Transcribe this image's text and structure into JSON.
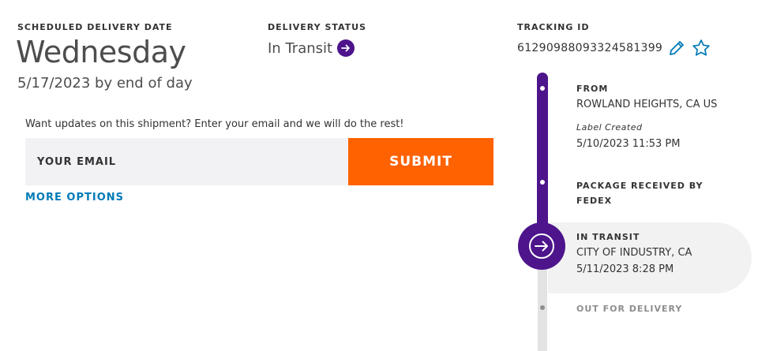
{
  "delivery": {
    "scheduled_label": "SCHEDULED DELIVERY DATE",
    "day": "Wednesday",
    "date_line": "5/17/2023 by end of day"
  },
  "status": {
    "label": "DELIVERY STATUS",
    "value": "In Transit"
  },
  "tracking": {
    "label": "TRACKING ID",
    "id": "612909880933245813 99"
  },
  "updates": {
    "prompt": "Want updates on this shipment? Enter your email and we will do the rest!",
    "email_placeholder": "YOUR EMAIL",
    "submit_label": "SUBMIT",
    "more_options": "MORE OPTIONS"
  },
  "timeline": {
    "events": [
      {
        "title": "FROM",
        "location": "ROWLAND HEIGHTS, CA US",
        "sub": "Label Created",
        "time": "5/10/2023 11:53 PM"
      },
      {
        "title_line1": "PACKAGE RECEIVED BY",
        "title_line2": "FEDEX"
      },
      {
        "title": "IN TRANSIT",
        "location": "CITY OF INDUSTRY, CA",
        "time": "5/11/2023 8:28 PM"
      },
      {
        "title": "OUT FOR DELIVERY"
      }
    ]
  },
  "colors": {
    "brand_purple": "#4d148c",
    "brand_orange": "#ff6200",
    "link_blue": "#007ab7"
  },
  "icons": {
    "status": "arrow-right-circle-icon",
    "edit": "pencil-icon",
    "favorite": "star-icon",
    "current": "arrow-right-circle-icon"
  }
}
